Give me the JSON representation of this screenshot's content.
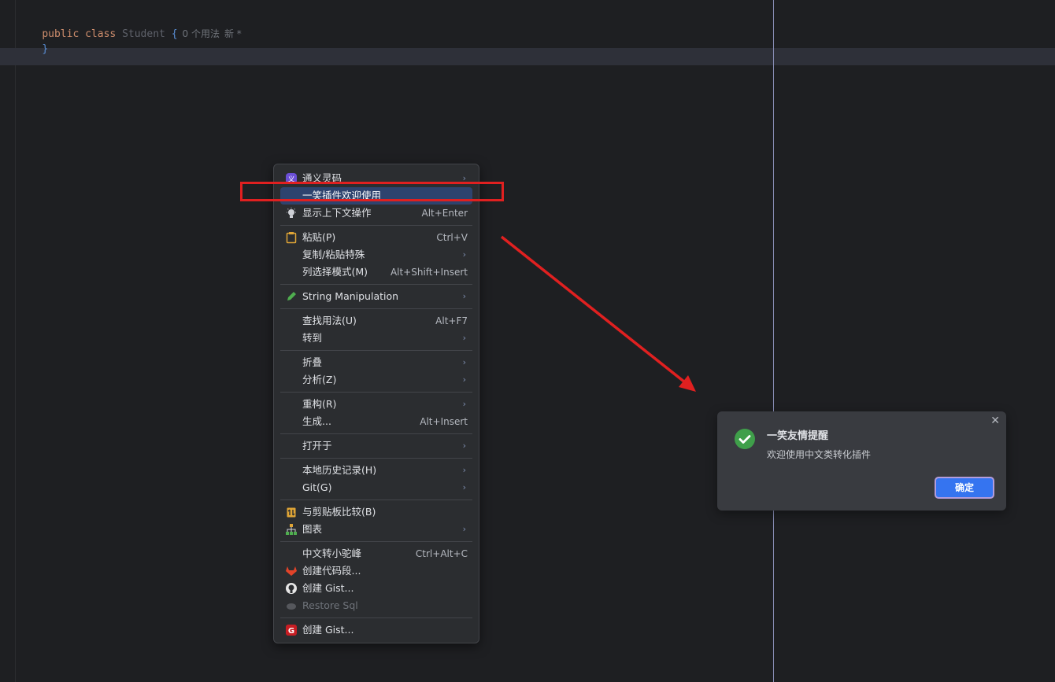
{
  "editor": {
    "code_kw1": "public",
    "code_kw2": "class",
    "code_class": "Student",
    "code_open": "{",
    "inlay_usages": "0 个用法",
    "inlay_new": "新 *",
    "code_close": "}"
  },
  "menu": {
    "items": [
      {
        "label": "通义灵码",
        "icon": "tongyi-icon",
        "submenu": true
      },
      {
        "label": "一笑插件欢迎使用",
        "selected": true
      },
      {
        "label": "显示上下文操作",
        "icon": "bulb-icon",
        "shortcut": "Alt+Enter"
      },
      {
        "label": "粘贴(P)",
        "icon": "clipboard-icon",
        "shortcut": "Ctrl+V"
      },
      {
        "label": "复制/粘贴特殊",
        "submenu": true
      },
      {
        "label": "列选择模式(M)",
        "shortcut": "Alt+Shift+Insert"
      },
      {
        "label": "String Manipulation",
        "icon": "pencil-icon",
        "submenu": true
      },
      {
        "label": "查找用法(U)",
        "shortcut": "Alt+F7"
      },
      {
        "label": "转到",
        "submenu": true
      },
      {
        "label": "折叠",
        "submenu": true
      },
      {
        "label": "分析(Z)",
        "submenu": true
      },
      {
        "label": "重构(R)",
        "submenu": true
      },
      {
        "label": "生成...",
        "shortcut": "Alt+Insert"
      },
      {
        "label": "打开于",
        "submenu": true
      },
      {
        "label": "本地历史记录(H)",
        "submenu": true
      },
      {
        "label": "Git(G)",
        "submenu": true
      },
      {
        "label": "与剪贴板比较(B)",
        "icon": "compare-clipboard-icon"
      },
      {
        "label": "图表",
        "icon": "diagram-icon",
        "submenu": true
      },
      {
        "label": "中文转小驼峰",
        "shortcut": "Ctrl+Alt+C"
      },
      {
        "label": "创建代码段...",
        "icon": "gitlab-icon"
      },
      {
        "label": "创建 Gist...",
        "icon": "github-icon"
      },
      {
        "label": "Restore Sql",
        "icon": "restore-sql-icon",
        "disabled": true
      },
      {
        "label": "创建 Gist...",
        "icon": "gitee-icon"
      }
    ],
    "arrow_glyph": "›"
  },
  "notification": {
    "title": "一笑友情提醒",
    "message": "欢迎使用中文类转化插件",
    "button": "确定",
    "close_glyph": "✕",
    "success_color": "#3f9f4a"
  },
  "annotation": {
    "color": "#e02020"
  }
}
